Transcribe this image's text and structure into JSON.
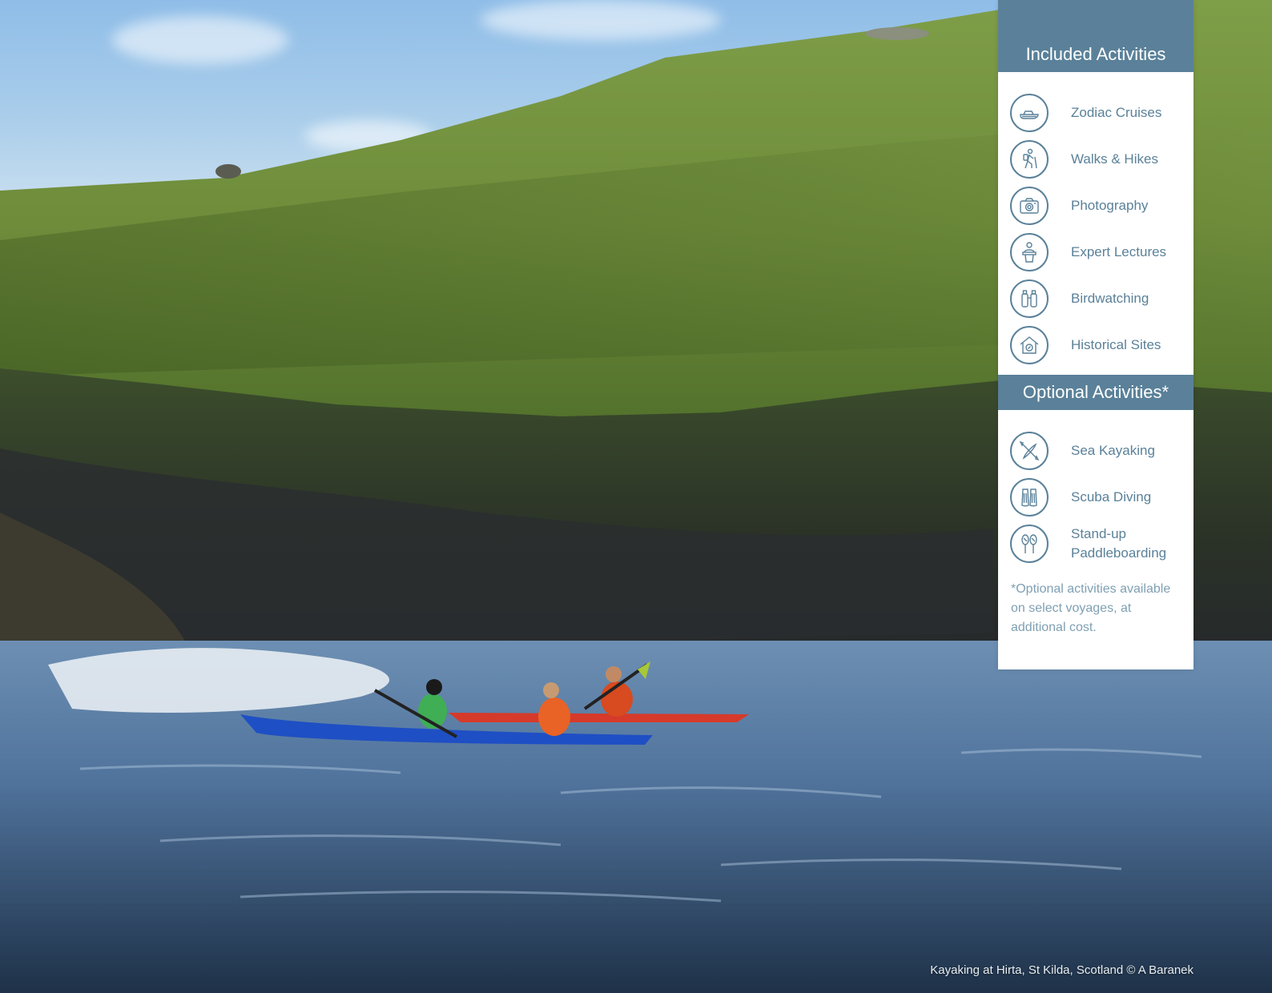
{
  "included": {
    "title": "Included Activities",
    "items": [
      {
        "label": "Zodiac Cruises",
        "icon": "zodiac-boat-icon"
      },
      {
        "label": "Walks & Hikes",
        "icon": "hiker-icon"
      },
      {
        "label": "Photography",
        "icon": "camera-icon"
      },
      {
        "label": "Expert Lectures",
        "icon": "lecturer-icon"
      },
      {
        "label": "Birdwatching",
        "icon": "binoculars-icon"
      },
      {
        "label": "Historical Sites",
        "icon": "historic-house-icon"
      }
    ]
  },
  "optional": {
    "title": "Optional Activities*",
    "items": [
      {
        "label": "Sea Kayaking",
        "icon": "kayak-icon"
      },
      {
        "label": "Scuba Diving",
        "icon": "flippers-icon"
      },
      {
        "label": "Stand-up Paddleboarding",
        "icon": "paddleboard-icon"
      }
    ],
    "footnote": "*Optional activities available on select voyages, at additional cost."
  },
  "photo": {
    "caption": "Kayaking at Hirta, St Kilda, Scotland © A Baranek"
  },
  "colors": {
    "panel_header": "#5a8199",
    "panel_text": "#5a8199",
    "footnote_text": "#7fa0b3"
  }
}
